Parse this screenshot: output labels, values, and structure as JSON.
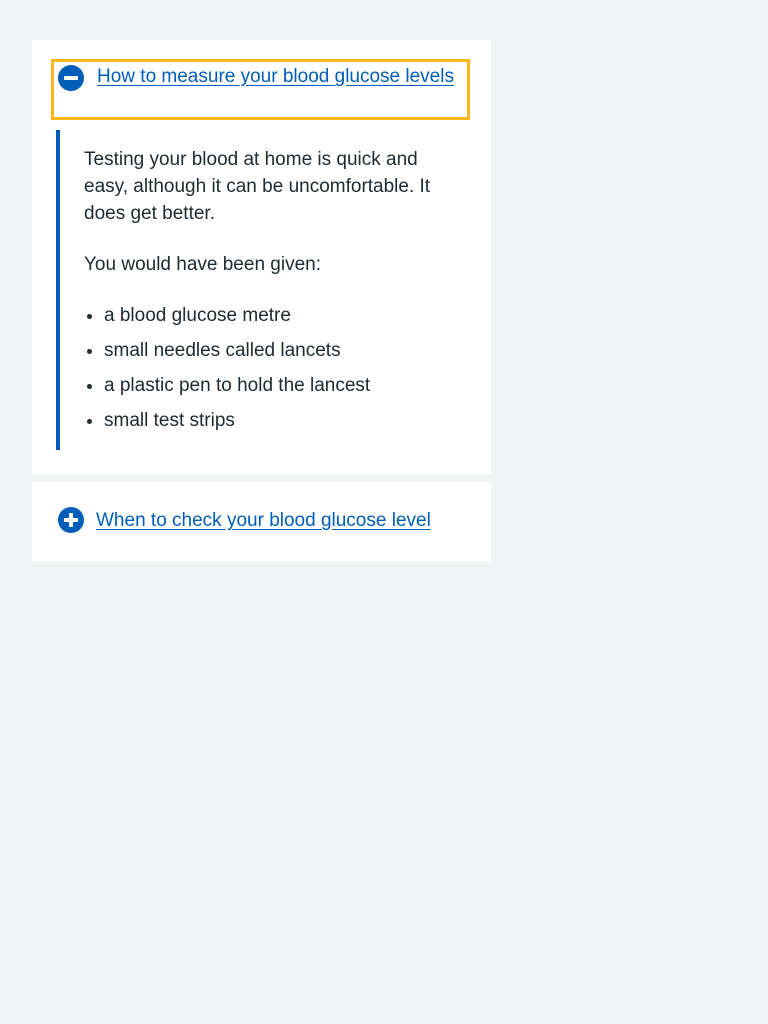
{
  "accordion": [
    {
      "summary": "How to measure your blood glucose levels",
      "state": "open",
      "icon": "minus-circle-icon",
      "paragraphs": [
        "Testing your blood at home is quick and easy, although it can be uncomfortable. It does get better.",
        "You would have been given:"
      ],
      "list_items": [
        "a blood glucose metre",
        "small needles called lancets",
        "a plastic pen to hold the lancest",
        "small test strips"
      ]
    },
    {
      "summary": "When to check your blood glucose level",
      "state": "closed",
      "icon": "plus-circle-icon"
    }
  ],
  "colors": {
    "page_background": "#f0f4f5",
    "link": "#005eb8",
    "focus_outline": "#ffb81c",
    "text": "#212b32",
    "panel": "#ffffff"
  }
}
